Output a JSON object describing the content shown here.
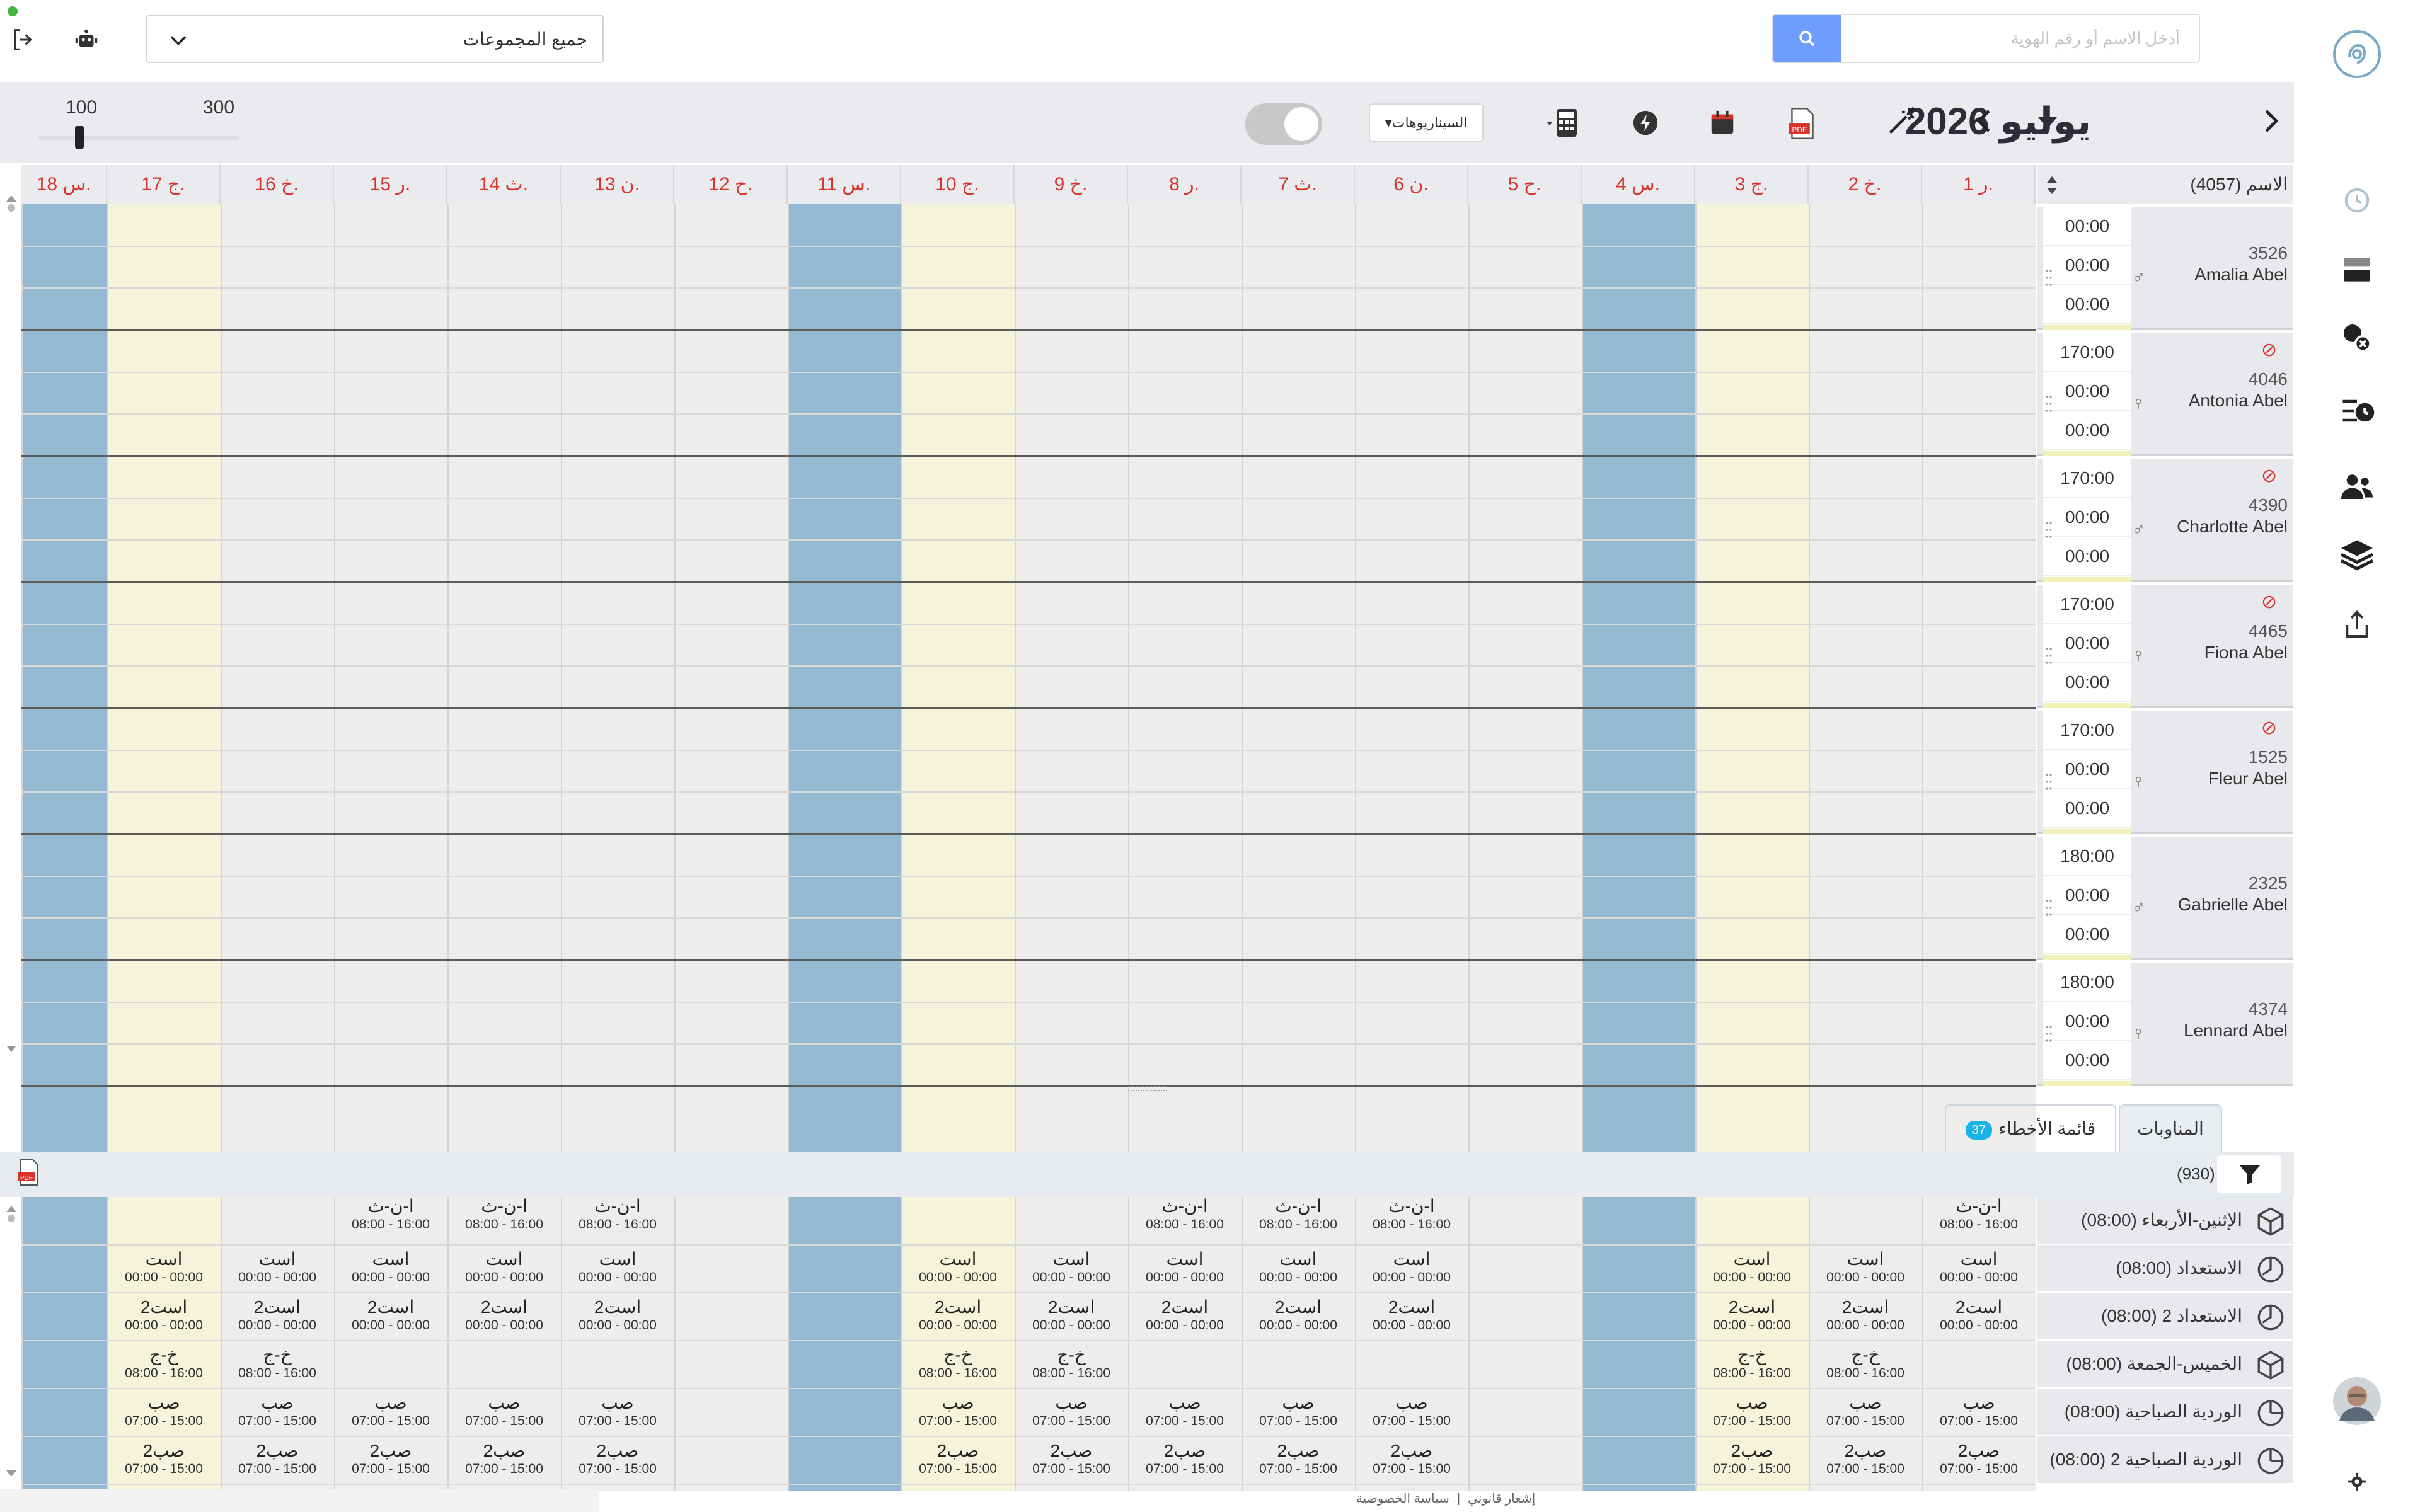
{
  "top": {
    "group_select": "جميع المجموعات",
    "search_placeholder": "أدخل الاسم أو رقم الهوية"
  },
  "toolbar": {
    "month": "يوليو 2026",
    "scenarios": "السيناريوهات",
    "zoom_min": "100",
    "zoom_max": "300",
    "zoom_value": 100
  },
  "days": [
    "ر 1.",
    "خ 2.",
    "ج 3.",
    "س 4.",
    "ح 5.",
    "ن 6.",
    "ث 7.",
    "ر 8.",
    "خ 9.",
    "ج 10.",
    "س 11.",
    "ح 12.",
    "ن 13.",
    "ث 14.",
    "ر 15.",
    "خ 16.",
    "ج 17.",
    "س 18."
  ],
  "day_types": [
    "w",
    "w",
    "y",
    "b",
    "w",
    "w",
    "w",
    "w",
    "w",
    "y",
    "b",
    "w",
    "w",
    "w",
    "w",
    "w",
    "y",
    "b"
  ],
  "names_header": "الاسم (4057)",
  "employees": [
    {
      "id": "3526",
      "name": "Amalia Abel",
      "gender": "♂",
      "hours": [
        "00:00",
        "00:00",
        "00:00"
      ],
      "cancel": false
    },
    {
      "id": "4046",
      "name": "Antonia Abel",
      "gender": "♀",
      "hours": [
        "170:00",
        "00:00",
        "00:00"
      ],
      "cancel": true
    },
    {
      "id": "4390",
      "name": "Charlotte Abel",
      "gender": "♂",
      "hours": [
        "170:00",
        "00:00",
        "00:00"
      ],
      "cancel": true
    },
    {
      "id": "4465",
      "name": "Fiona Abel",
      "gender": "♀",
      "hours": [
        "170:00",
        "00:00",
        "00:00"
      ],
      "cancel": true
    },
    {
      "id": "1525",
      "name": "Fleur Abel",
      "gender": "♀",
      "hours": [
        "170:00",
        "00:00",
        "00:00"
      ],
      "cancel": true
    },
    {
      "id": "2325",
      "name": "Gabrielle Abel",
      "gender": "♂",
      "hours": [
        "180:00",
        "00:00",
        "00:00"
      ],
      "cancel": false
    },
    {
      "id": "4374",
      "name": "Lennard Abel",
      "gender": "♀",
      "hours": [
        "180:00",
        "00:00",
        "00:00"
      ],
      "cancel": false
    }
  ],
  "tabs": {
    "shifts": "المناوبات",
    "errors": "قائمة الأخطاء",
    "errors_count": "37"
  },
  "shifts_count": "(930)",
  "shifts": [
    {
      "label": "الإثنين-الأربعاء (08:00)",
      "icon": "cube"
    },
    {
      "label": "الاستعداد (08:00)",
      "icon": "clock"
    },
    {
      "label": "الاستعداد 2 (08:00)",
      "icon": "clock"
    },
    {
      "label": "الخميس-الجمعة (08:00)",
      "icon": "cube"
    },
    {
      "label": "الوردية الصباحية (08:00)",
      "icon": "pie"
    },
    {
      "label": "الوردية الصباحية 2 (08:00)",
      "icon": "pie"
    }
  ],
  "shift_cells": [
    {
      "code": "ا-ن-ث",
      "hours": "08:00 - 16:00",
      "days": [
        1,
        8,
        7,
        6,
        15,
        14,
        13
      ]
    },
    {
      "code": "است",
      "hours": "00:00 - 00:00",
      "days": [
        3,
        2,
        1,
        10,
        9,
        8,
        7,
        6,
        17,
        16,
        15,
        14,
        13
      ]
    },
    {
      "code": "است2",
      "hours": "00:00 - 00:00",
      "days": [
        3,
        2,
        1,
        10,
        9,
        8,
        7,
        6,
        17,
        16,
        15,
        14,
        13
      ]
    },
    {
      "code": "خ-ج",
      "hours": "08:00 - 16:00",
      "days": [
        3,
        2,
        10,
        9,
        17,
        16
      ]
    },
    {
      "code": "صب",
      "hours": "07:00 - 15:00",
      "days": [
        3,
        2,
        1,
        10,
        9,
        8,
        7,
        6,
        17,
        16,
        15,
        14,
        13
      ]
    },
    {
      "code": "صب2",
      "hours": "07:00 - 15:00",
      "days": [
        3,
        2,
        1,
        10,
        9,
        8,
        7,
        6,
        17,
        16,
        15,
        14,
        13
      ]
    }
  ],
  "footer": {
    "legal": "إشعار قانوني",
    "privacy": "سياسة الخصوصية"
  },
  "colors": {
    "weekend_blue": "#95b9d3",
    "friday_yellow": "#f4f4da",
    "day_header_red": "#d9332c",
    "search_blue": "#6d9eff",
    "badge_cyan": "#19b4e6"
  }
}
